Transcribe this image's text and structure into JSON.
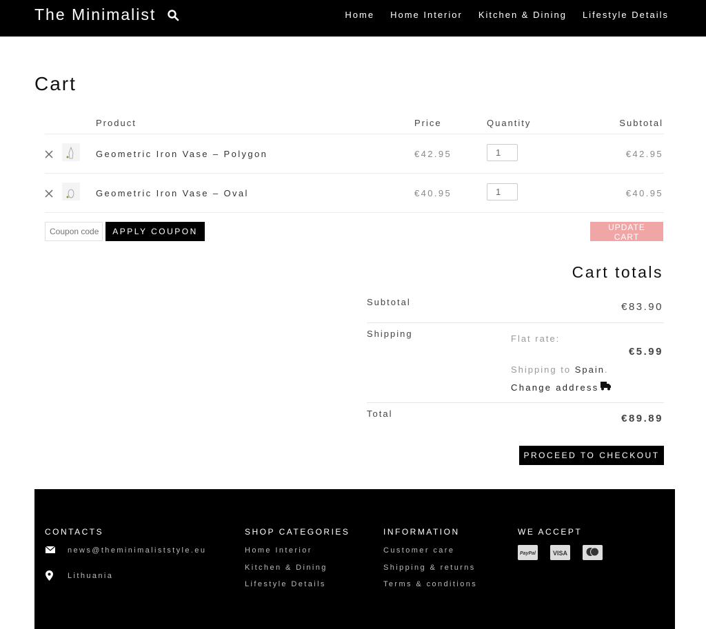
{
  "header": {
    "logo": "The Minimalist",
    "nav": [
      "Home",
      "Home Interior",
      "Kitchen & Dining",
      "Lifestyle Details"
    ]
  },
  "page": {
    "title": "Cart"
  },
  "table": {
    "headers": {
      "product": "Product",
      "price": "Price",
      "quantity": "Quantity",
      "subtotal": "Subtotal"
    },
    "rows": [
      {
        "name": "Geometric Iron Vase – Polygon",
        "price": "€42.95",
        "quantity": "1",
        "subtotal": "€42.95"
      },
      {
        "name": "Geometric Iron Vase – Oval",
        "price": "€40.95",
        "quantity": "1",
        "subtotal": "€40.95"
      }
    ]
  },
  "coupon": {
    "placeholder": "Coupon code",
    "apply_label": "APPLY COUPON"
  },
  "update_label": "UPDATE CART",
  "totals": {
    "title": "Cart totals",
    "subtotal_label": "Subtotal",
    "subtotal_value": "€83.90",
    "shipping_label": "Shipping",
    "shipping_method": "Flat rate:",
    "shipping_value": "€5.99",
    "shipping_to_prefix": "Shipping to",
    "shipping_country": "Spain",
    "shipping_to_suffix": ".",
    "change_address": "Change address",
    "total_label": "Total",
    "total_value": "€89.89"
  },
  "checkout_label": "PROCEED TO CHECKOUT",
  "footer": {
    "contacts": {
      "title": "CONTACTS",
      "email": "news@theminimaliststyle.eu",
      "location": "Lithuania"
    },
    "categories": {
      "title": "SHOP CATEGORIES",
      "items": [
        "Home Interior",
        "Kitchen & Dining",
        "Lifestyle Details"
      ]
    },
    "information": {
      "title": "INFORMATION",
      "items": [
        "Customer care",
        "Shipping & returns",
        "Terms & conditions"
      ]
    },
    "accept": {
      "title": "WE ACCEPT",
      "paypal": "PayPal",
      "visa": "VISA"
    }
  },
  "colors": {
    "update_button": "#f0a6a6",
    "footer_bg": "#000000",
    "topbar_bg": "#000000"
  }
}
